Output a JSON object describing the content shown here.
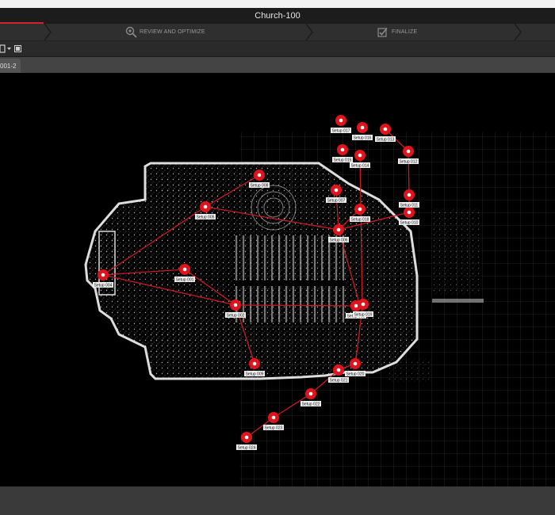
{
  "window": {
    "title": "Church-100"
  },
  "steps": [
    {
      "label": "REVIEW AND OPTIMIZE",
      "icon": "review-optimize-icon"
    },
    {
      "label": "FINALIZE",
      "icon": "finalize-icon"
    }
  ],
  "tab": {
    "label": "001-2"
  },
  "colors": {
    "accent": "#d0232a",
    "setup_marker": "#e0141c",
    "link_line": "#cc1a22"
  },
  "setups": [
    {
      "label": "Setup 001"
    },
    {
      "label": "Setup 002"
    },
    {
      "label": "Setup 004"
    },
    {
      "label": "Setup 005"
    },
    {
      "label": "Setup 006"
    },
    {
      "label": "Setup 007"
    },
    {
      "label": "Setup 008"
    },
    {
      "label": "Setup 009"
    },
    {
      "label": "Setup 010"
    },
    {
      "label": "Setup 011"
    },
    {
      "label": "Setup 012"
    },
    {
      "label": "Setup 013"
    },
    {
      "label": "Setup 014"
    },
    {
      "label": "Setup 015"
    },
    {
      "label": "Setup 016"
    },
    {
      "label": "Setup 017"
    },
    {
      "label": "Setup 018"
    },
    {
      "label": "Setup 019"
    },
    {
      "label": "Setup 020"
    },
    {
      "label": "Setup 021"
    },
    {
      "label": "Setup 022"
    },
    {
      "label": "Setup 023"
    },
    {
      "label": "Setup 024"
    },
    {
      "label": "Setup 003"
    }
  ]
}
